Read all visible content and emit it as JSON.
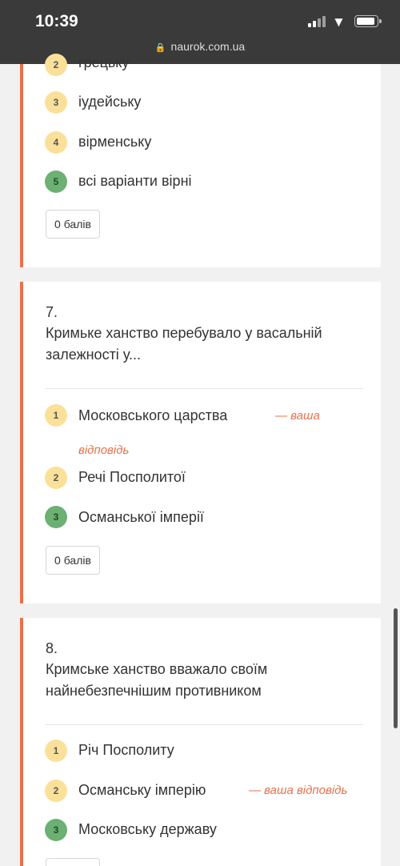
{
  "status": {
    "time": "10:39",
    "url": "naurok.com.ua"
  },
  "icons": {
    "lock": "lock-icon",
    "wifi": "wifi-icon",
    "battery": "battery-icon",
    "signal": "signal-icon"
  },
  "colors": {
    "accent": "#e8714a",
    "option_badge": "#fbe09a",
    "correct_badge": "#6cb073"
  },
  "q6": {
    "options": [
      {
        "num": "2",
        "text": "грецьку"
      },
      {
        "num": "3",
        "text": "іудейську"
      },
      {
        "num": "4",
        "text": "вірменську"
      },
      {
        "num": "5",
        "text": "всі варіанти вірні",
        "correct": true
      }
    ],
    "score": "0 балів"
  },
  "q7": {
    "number": "7.",
    "text": "Кримьке ханство перебувало у васальній залежності у...",
    "options": [
      {
        "num": "1",
        "text": "Московського царства",
        "your_answer_part1": "— ваша",
        "your_answer_part2": "відповідь"
      },
      {
        "num": "2",
        "text": "Речі Посполитої"
      },
      {
        "num": "3",
        "text": "Османської імперії",
        "correct": true
      }
    ],
    "score": "0 балів"
  },
  "q8": {
    "number": "8.",
    "text": "Кримське ханство вважало своїм найнебезпечнішим противником",
    "options": [
      {
        "num": "1",
        "text": "Річ Посполиту"
      },
      {
        "num": "2",
        "text": "Османську імперію",
        "your_answer": "— ваша відповідь"
      },
      {
        "num": "3",
        "text": "Московську державу",
        "correct": true
      }
    ]
  }
}
